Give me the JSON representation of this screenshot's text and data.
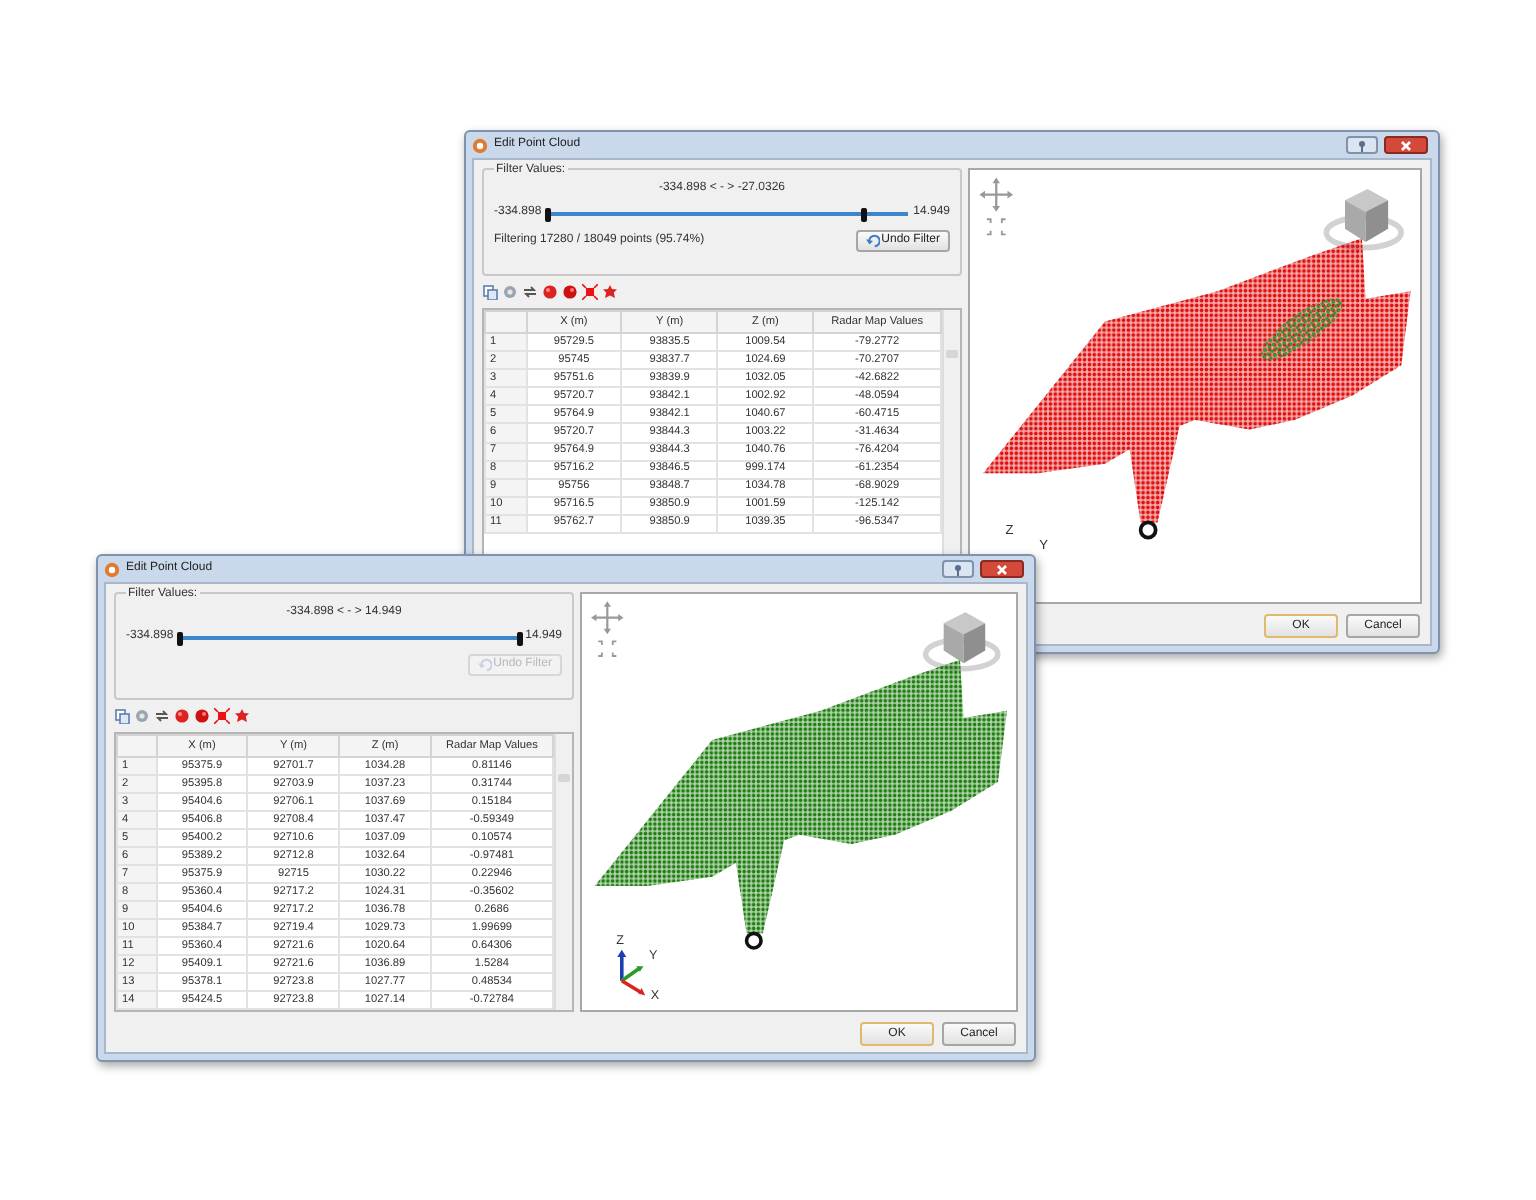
{
  "windows": [
    {
      "title": "Edit Point Cloud",
      "filter": {
        "legend": "Filter Values:",
        "range": "-334.898 < - > -27.0326",
        "min": "-334.898",
        "max": "14.949",
        "thumbs": [
          {
            "level": 0
          },
          {
            "level": 0.88
          }
        ],
        "status": "Filtering 17280 / 18049 points (95.74%)",
        "undo": {
          "label": "Undo Filter",
          "disabled": false
        }
      },
      "table": {
        "columns": [
          "",
          "X (m)",
          "Y (m)",
          "Z (m)",
          "Radar Map Values"
        ],
        "rows": [
          [
            "1",
            "95729.5",
            "93835.5",
            "1009.54",
            "-79.2772"
          ],
          [
            "2",
            "95745",
            "93837.7",
            "1024.69",
            "-70.2707"
          ],
          [
            "3",
            "95751.6",
            "93839.9",
            "1032.05",
            "-42.6822"
          ],
          [
            "4",
            "95720.7",
            "93842.1",
            "1002.92",
            "-48.0594"
          ],
          [
            "5",
            "95764.9",
            "93842.1",
            "1040.67",
            "-60.4715"
          ],
          [
            "6",
            "95720.7",
            "93844.3",
            "1003.22",
            "-31.4634"
          ],
          [
            "7",
            "95764.9",
            "93844.3",
            "1040.76",
            "-76.4204"
          ],
          [
            "8",
            "95716.2",
            "93846.5",
            "999.174",
            "-61.2354"
          ],
          [
            "9",
            "95756",
            "93848.7",
            "1034.78",
            "-68.9029"
          ],
          [
            "10",
            "95716.5",
            "93850.9",
            "1001.59",
            "-125.142"
          ],
          [
            "11",
            "95762.7",
            "93850.9",
            "1039.35",
            "-96.5347"
          ]
        ]
      },
      "view": {
        "color": "#e01010",
        "selection": true,
        "axes": [
          "Z",
          "Y"
        ]
      },
      "buttons": [
        {
          "label": "OK",
          "default": true
        },
        {
          "label": "Cancel",
          "default": false
        }
      ]
    },
    {
      "title": "Edit Point Cloud",
      "filter": {
        "legend": "Filter Values:",
        "range": "-334.898 < - > 14.949",
        "min": "-334.898",
        "max": "14.949",
        "thumbs": [
          {
            "level": 0
          },
          {
            "level": 1
          }
        ],
        "undo": {
          "label": "Undo Filter",
          "disabled": true
        }
      },
      "table": {
        "columns": [
          "",
          "X (m)",
          "Y (m)",
          "Z (m)",
          "Radar Map Values"
        ],
        "rows": [
          [
            "1",
            "95375.9",
            "92701.7",
            "1034.28",
            "0.81146"
          ],
          [
            "2",
            "95395.8",
            "92703.9",
            "1037.23",
            "0.31744"
          ],
          [
            "3",
            "95404.6",
            "92706.1",
            "1037.69",
            "0.15184"
          ],
          [
            "4",
            "95406.8",
            "92708.4",
            "1037.47",
            "-0.59349"
          ],
          [
            "5",
            "95400.2",
            "92710.6",
            "1037.09",
            "0.10574"
          ],
          [
            "6",
            "95389.2",
            "92712.8",
            "1032.64",
            "-0.97481"
          ],
          [
            "7",
            "95375.9",
            "92715",
            "1030.22",
            "0.22946"
          ],
          [
            "8",
            "95360.4",
            "92717.2",
            "1024.31",
            "-0.35602"
          ],
          [
            "9",
            "95404.6",
            "92717.2",
            "1036.78",
            "0.2686"
          ],
          [
            "10",
            "95384.7",
            "92719.4",
            "1029.73",
            "1.99699"
          ],
          [
            "11",
            "95360.4",
            "92721.6",
            "1020.64",
            "0.64306"
          ],
          [
            "12",
            "95409.1",
            "92721.6",
            "1036.89",
            "1.5284"
          ],
          [
            "13",
            "95378.1",
            "92723.8",
            "1027.77",
            "0.48534"
          ],
          [
            "14",
            "95424.5",
            "92723.8",
            "1027.14",
            "-0.72784"
          ]
        ]
      },
      "view": {
        "color": "#1f7f10",
        "selection": false,
        "axes": [
          "Z",
          "Y",
          "X"
        ]
      },
      "buttons": [
        {
          "label": "OK",
          "default": true
        },
        {
          "label": "Cancel",
          "default": false
        }
      ]
    }
  ]
}
